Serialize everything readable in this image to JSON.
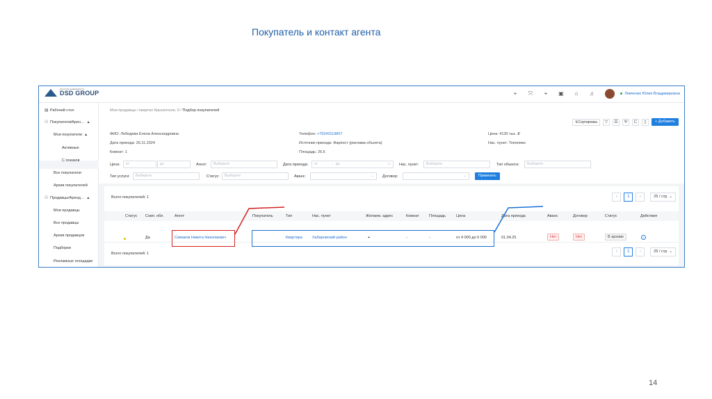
{
  "slide": {
    "title": "Покупатель и контакт агента",
    "page": "14"
  },
  "header": {
    "logo_small": "Агентство недвижимости",
    "logo_name": "DSD GROUP",
    "user_name": "Левченко Юлия Владимировна"
  },
  "sidebar": {
    "items": [
      {
        "label": "Рабочий стол"
      },
      {
        "label": "Покупатели/Арен…"
      },
      {
        "label": "Мои покупатели"
      },
      {
        "label": "Активные"
      },
      {
        "label": "С показов"
      },
      {
        "label": "Все покупатели"
      },
      {
        "label": "Архив покупателей"
      },
      {
        "label": "Продавцы/Аренд…"
      },
      {
        "label": "Мои продавцы"
      },
      {
        "label": "Все продавцы"
      },
      {
        "label": "Архив продавцов"
      },
      {
        "label": "Подборки"
      },
      {
        "label": "Рекламные площадки"
      }
    ]
  },
  "breadcrumb": {
    "path": "Мои продавцы / квартал Крылатское, 9 / ",
    "current": "Подбор покупателей"
  },
  "toolbar": {
    "sort_label": "Сортировка",
    "add_label": "+ Добавить"
  },
  "info": {
    "fio_label": "ФИО:",
    "fio": "Лебедева Елена Александровна",
    "date_label": "Дата прихода:",
    "date": "26.11.2024",
    "rooms_label": "Комнат:",
    "rooms": "1",
    "phone_label": "Телефон:",
    "phone": "+79243119807",
    "source_label": "Источник прихода:",
    "source": "Фарпост (реклама объекта)",
    "area_label": "Площадь:",
    "area": "26.6",
    "price_label": "Цена:",
    "price": "4130 тыс. ₽",
    "city_label": "Нас. пункт:",
    "city": "Тополево"
  },
  "filters": {
    "price_label": "Цена:",
    "from": "от",
    "to": "до",
    "agent_label": "Агент:",
    "choose": "Выберите",
    "date_label": "Дата прихода:",
    "city_label": "Нас. пункт:",
    "object_type_label": "Тип объекта:",
    "service_label": "Тип услуги:",
    "status_label": "Статус:",
    "advance_label": "Аванс:",
    "contract_label": "Договор:",
    "apply": "Применить"
  },
  "table": {
    "total": "Всего покупателей: 1",
    "page": "1",
    "page_size": "25 / стр.",
    "columns": [
      "Статус",
      "Совп. обл.",
      "Агент",
      "Покупатель",
      "Тип",
      "Нас. пункт",
      "Желаем. адрес",
      "Комнат",
      "Площадь",
      "Цена",
      "Дата прихода",
      "Аванс",
      "Договор",
      "Статус",
      "Действия"
    ],
    "row": {
      "match": "Да",
      "agent": "Симаков Никита Николаевич",
      "type": "Квартира",
      "city": "Хабаровский район",
      "rooms": "-",
      "area": "-",
      "price": "от 4 000 до 6 000",
      "date": "01.04.25",
      "advance": "Нет",
      "contract": "Нет",
      "status": "В архиве"
    }
  },
  "colors": {
    "accent": "#1f7fe0",
    "annotation_red": "#d42020",
    "annotation_blue": "#1a6fd6"
  }
}
